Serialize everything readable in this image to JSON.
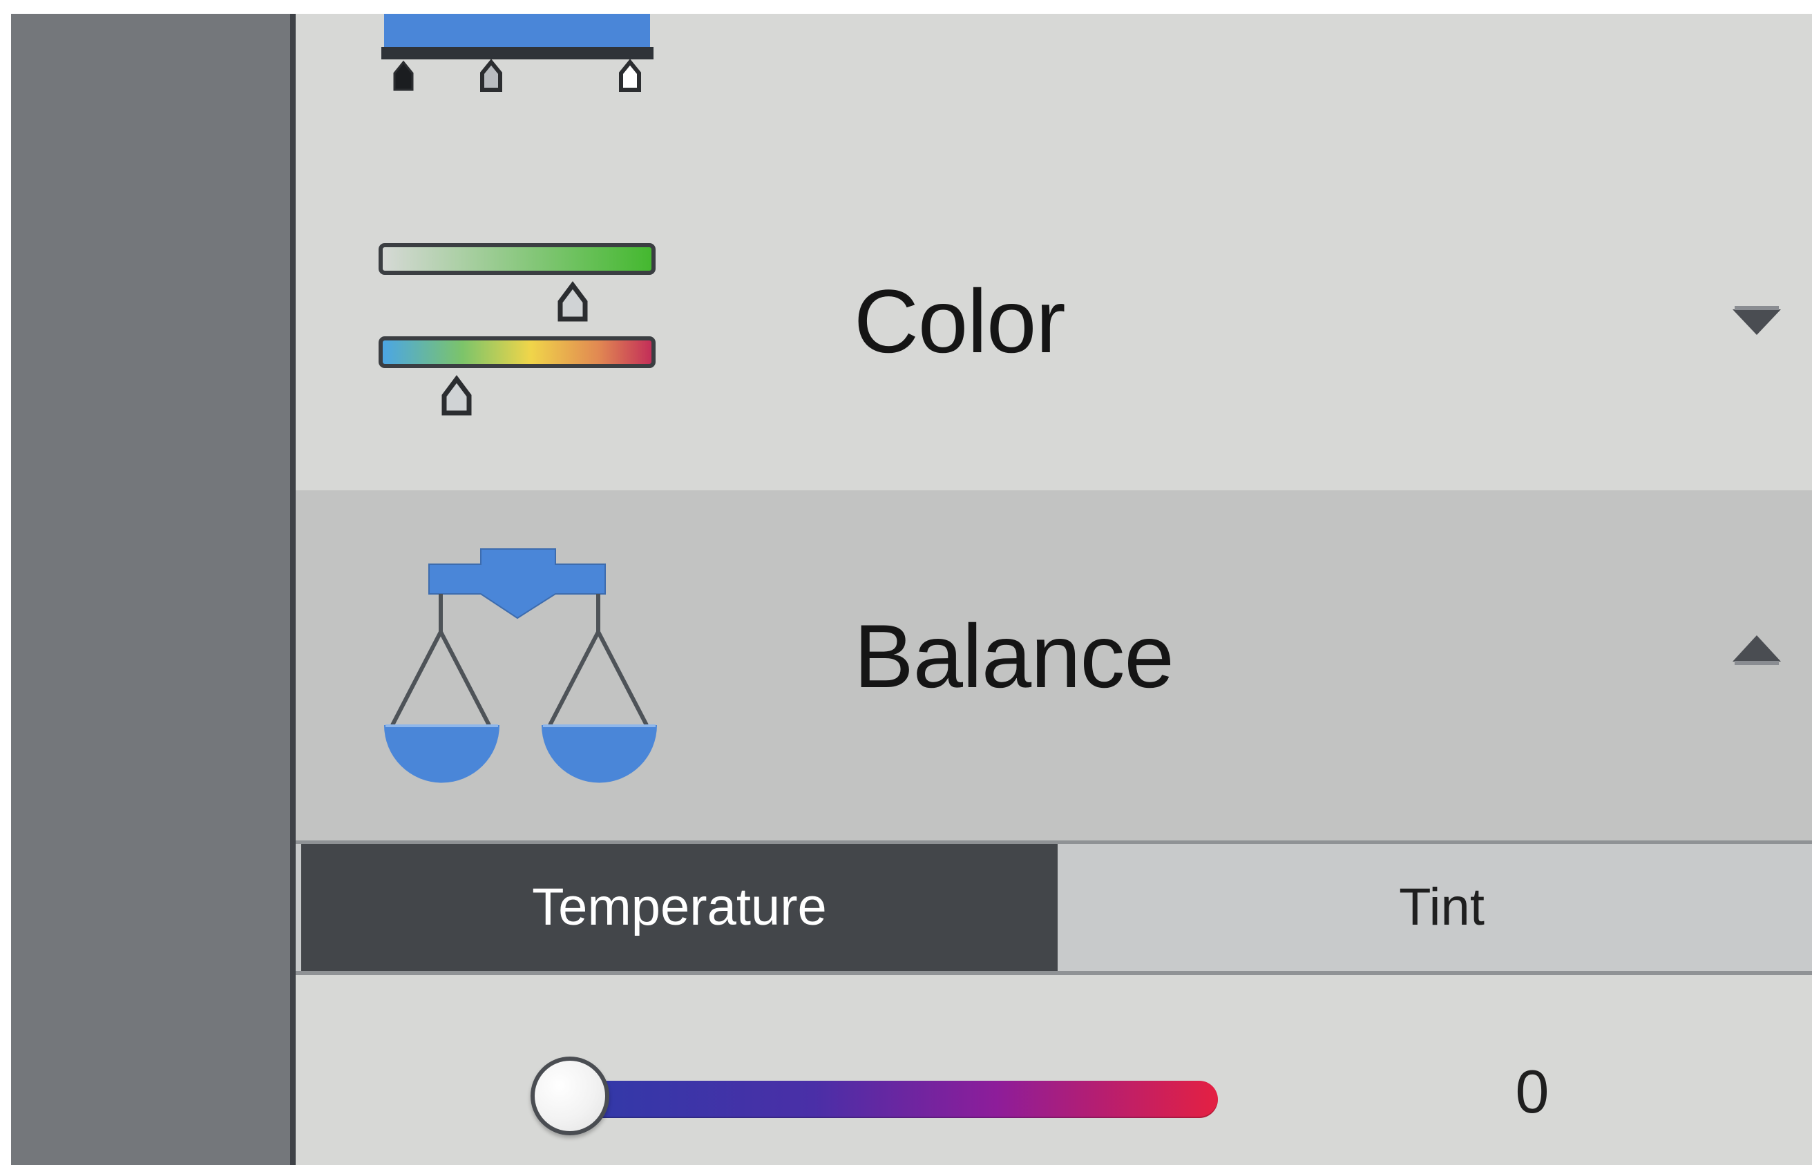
{
  "sections": {
    "color": {
      "title": "Color",
      "state": "collapsed",
      "icon": "color-sliders-icon",
      "chevron_icon": "chevron-down-icon"
    },
    "balance": {
      "title": "Balance",
      "state": "expanded",
      "icon": "balance-scale-icon",
      "chevron_icon": "chevron-up-icon"
    },
    "levels": {
      "icon": "levels-icon"
    }
  },
  "balance": {
    "tabs": [
      {
        "label": "Temperature",
        "active": true
      },
      {
        "label": "Tint",
        "active": false
      }
    ],
    "temperature_value": "0"
  },
  "colors": {
    "accent_blue": "#4a86d8",
    "active_tab_bg": "#43464a",
    "panel_bg": "#d7d8d6",
    "selected_section_bg": "#c2c3c2",
    "slider_start": "#2d3ba8",
    "slider_end": "#e42042"
  }
}
